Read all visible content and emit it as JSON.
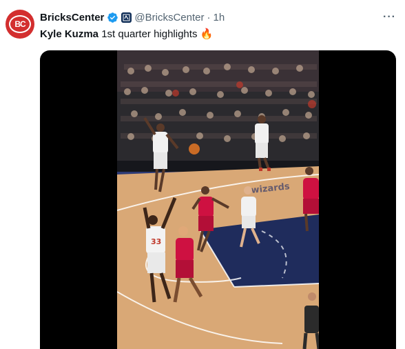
{
  "tweet": {
    "avatar_text": "BC",
    "display_name": "BricksCenter",
    "handle": "@BricksCenter",
    "separator": "·",
    "time": "1h",
    "more_label": "···",
    "text_bold": "Kyle Kuzma",
    "text_rest": " 1st quarter highlights",
    "emoji": "🔥"
  },
  "video": {
    "player_number": "33",
    "court_brand": "wizards"
  },
  "colors": {
    "verified": "#1d9bf0",
    "avatar": "#d32f2f",
    "raptors_red": "#ce1141",
    "court_wood": "#d9a876",
    "paint_navy": "#1f2c5c"
  }
}
